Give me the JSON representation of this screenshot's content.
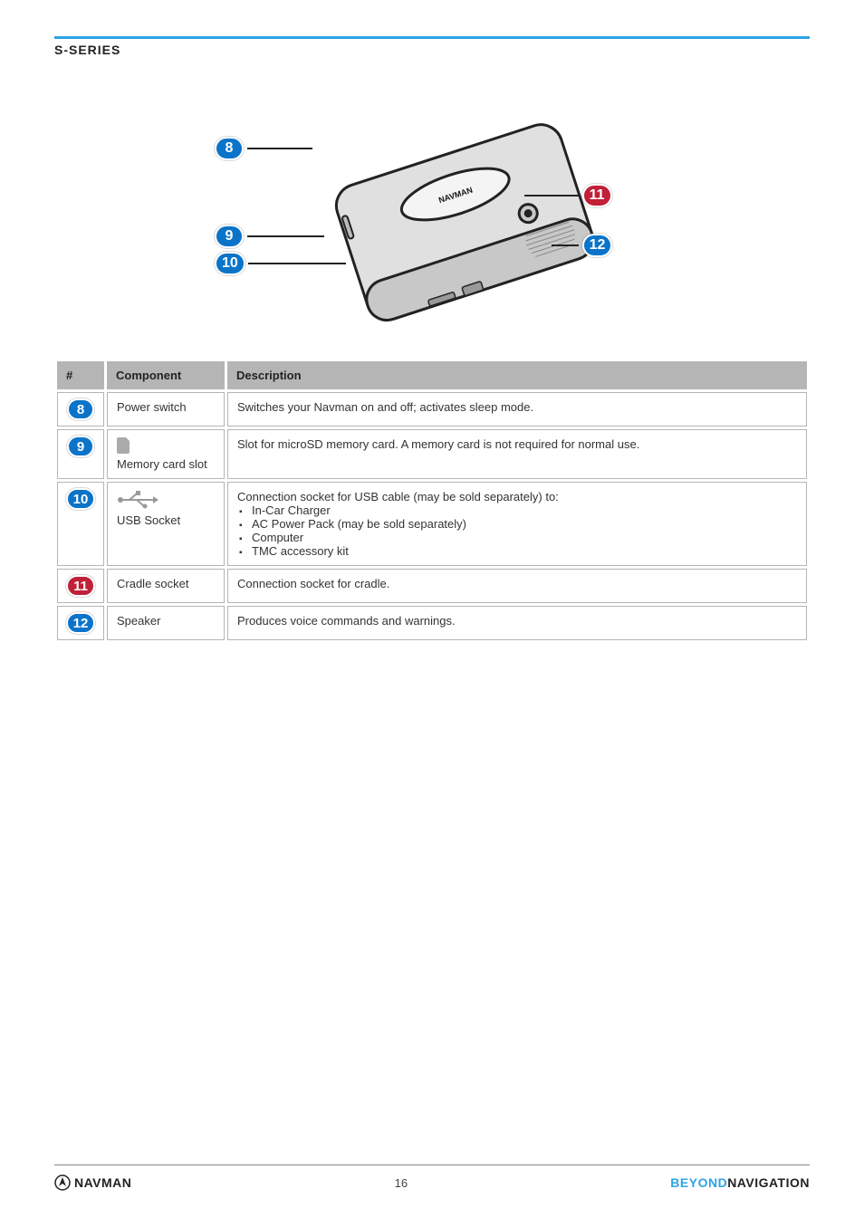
{
  "header": {
    "series": "S-Series"
  },
  "diagram": {
    "device_label": "NAVMAN",
    "callouts": [
      {
        "n": "8",
        "color": "blue"
      },
      {
        "n": "9",
        "color": "blue"
      },
      {
        "n": "10",
        "color": "blue"
      },
      {
        "n": "11",
        "color": "red"
      },
      {
        "n": "12",
        "color": "blue"
      }
    ]
  },
  "table": {
    "head": [
      "#",
      "Component",
      "Description"
    ],
    "rows": [
      {
        "num": "8",
        "color": "blue",
        "name": "Power switch",
        "desc": "Switches your Navman on and off; activates sleep mode."
      },
      {
        "num": "9",
        "color": "blue",
        "icon": "sd",
        "name": "Memory card slot",
        "desc": "Slot for microSD memory card. A memory card is not required for normal use."
      },
      {
        "num": "10",
        "color": "blue",
        "icon": "usb",
        "name": "USB Socket",
        "desc_lead": "Connection socket for USB cable (may be sold separately) to:",
        "desc_items": [
          "In-Car Charger",
          "AC Power Pack (may be sold separately)",
          "Computer",
          "TMC accessory kit"
        ]
      },
      {
        "num": "11",
        "color": "red",
        "name": "Cradle socket",
        "desc": "Connection socket for cradle."
      },
      {
        "num": "12",
        "color": "blue",
        "name": "Speaker",
        "desc": "Produces voice commands and warnings."
      }
    ]
  },
  "footer": {
    "brand": "NAVMAN",
    "page": "16",
    "tag_a": "BEYOND",
    "tag_b": "NAVIGATION"
  }
}
